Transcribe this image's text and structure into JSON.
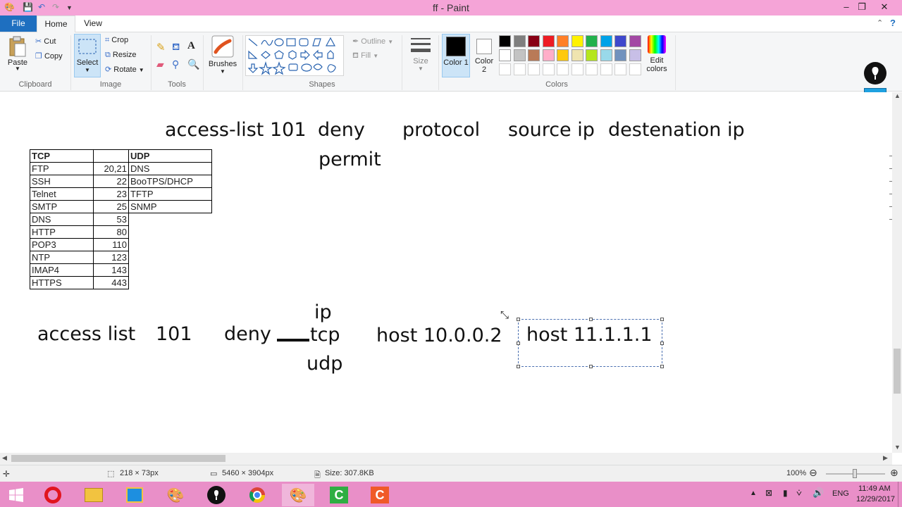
{
  "window": {
    "title": "ff - Paint",
    "minimize": "‒",
    "restore": "❐",
    "close": "✕"
  },
  "tabs": {
    "file": "File",
    "home": "Home",
    "view": "View"
  },
  "ribbon": {
    "clipboard": {
      "label": "Clipboard",
      "paste": "Paste",
      "cut": "Cut",
      "copy": "Copy"
    },
    "image": {
      "label": "Image",
      "select": "Select",
      "crop": "Crop",
      "resize": "Resize",
      "rotate": "Rotate"
    },
    "tools": {
      "label": "Tools"
    },
    "brushes": {
      "label": "Brushes"
    },
    "shapes": {
      "label": "Shapes",
      "outline": "Outline",
      "fill": "Fill"
    },
    "size": {
      "label": "Size"
    },
    "colors": {
      "label": "Colors",
      "color1": "Color 1",
      "color2": "Color 2",
      "edit": "Edit colors",
      "palette_row1": [
        "#000000",
        "#7f7f7f",
        "#880015",
        "#ed1c24",
        "#ff7f27",
        "#fff200",
        "#22b14c",
        "#00a2e8",
        "#3f48cc",
        "#a349a4"
      ],
      "palette_row2": [
        "#ffffff",
        "#c3c3c3",
        "#b97a57",
        "#ffaec9",
        "#ffc90e",
        "#efe4b0",
        "#b5e61d",
        "#99d9ea",
        "#7092be",
        "#c8bfe7"
      ]
    }
  },
  "canvas": {
    "header_line": {
      "access_list": "access-list 101",
      "deny": "deny",
      "permit": "permit",
      "protocol": "protocol",
      "source_ip": "source ip",
      "destination_ip": "destenation ip"
    },
    "tcp_table": {
      "header": [
        "TCP",
        ""
      ],
      "rows": [
        [
          "FTP",
          "20,21"
        ],
        [
          "SSH",
          "22"
        ],
        [
          "Telnet",
          "23"
        ],
        [
          "SMTP",
          "25"
        ],
        [
          "DNS",
          "53"
        ],
        [
          "HTTP",
          "80"
        ],
        [
          "POP3",
          "110"
        ],
        [
          "NTP",
          "123"
        ],
        [
          "IMAP4",
          "143"
        ],
        [
          "HTTPS",
          "443"
        ]
      ]
    },
    "udp_table": {
      "header": "UDP",
      "rows": [
        "DNS",
        "BooTPS/DHCP",
        "TFTP",
        "SNMP"
      ]
    },
    "example": {
      "access_list": "access list",
      "number": "101",
      "deny": "deny",
      "proto_ip": "ip",
      "proto_tcp": "tcp",
      "proto_udp": "udp",
      "host1": "host 10.0.0.2",
      "host2": "host 11.1.1.1"
    }
  },
  "status": {
    "selection": "218 × 73px",
    "image_size": "5460 × 3904px",
    "file_size": "Size: 307.8KB",
    "zoom": "100%"
  },
  "taskbar": {
    "language": "ENG",
    "time": "11:49 AM",
    "date": "12/29/2017"
  }
}
